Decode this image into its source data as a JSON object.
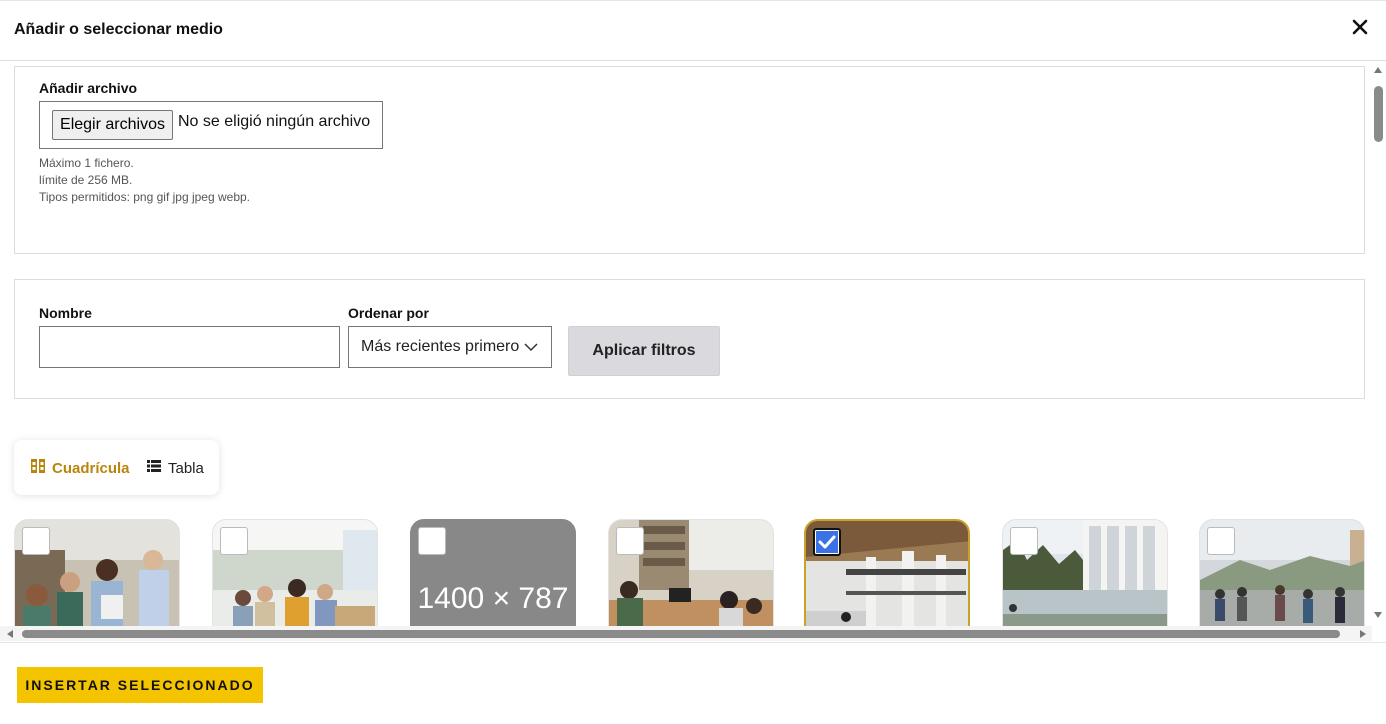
{
  "dialog": {
    "title": "Añadir o seleccionar medio",
    "close_icon": "close-icon"
  },
  "upload": {
    "label": "Añadir archivo",
    "choose_button": "Elegir archivos",
    "status": "No se eligió ningún archivo",
    "help": [
      "Máximo 1 fichero.",
      "límite de 256 MB.",
      "Tipos permitidos: png gif jpg jpeg webp."
    ]
  },
  "filters": {
    "name_label": "Nombre",
    "name_value": "",
    "sort_label": "Ordenar por",
    "sort_value": "Más recientes primero",
    "apply_button": "Aplicar filtros"
  },
  "view_toggle": {
    "grid_label": "Cuadrícula",
    "grid_icon": "grid-icon",
    "table_label": "Tabla",
    "table_icon": "list-icon",
    "active": "grid"
  },
  "media_items": [
    {
      "kind": "photo-students-library",
      "selected": false
    },
    {
      "kind": "photo-students-hall",
      "selected": false
    },
    {
      "kind": "placeholder",
      "text": "1400 × 787",
      "selected": false
    },
    {
      "kind": "photo-study-room",
      "selected": false
    },
    {
      "kind": "photo-atrium",
      "selected": true
    },
    {
      "kind": "photo-building",
      "selected": false
    },
    {
      "kind": "photo-campus-walk",
      "selected": false
    }
  ],
  "footer": {
    "insert_button": "INSERTAR SELECCIONADO"
  },
  "colors": {
    "accent": "#f5c400",
    "grid_active": "#b8860b",
    "selected_border": "#c9a227",
    "checkbox_checked": "#3b73e6"
  }
}
